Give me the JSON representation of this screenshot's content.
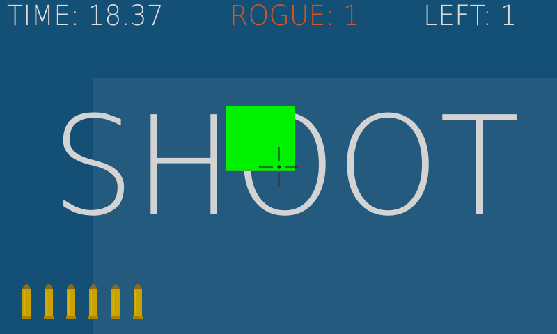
{
  "hud": {
    "time_text": "TIME: 18.37",
    "rogue_text": "ROGUE: 1",
    "left_text": "LEFT: 1"
  },
  "center_text": "SHOOT",
  "ammo": {
    "remaining": 6
  },
  "colors": {
    "background": "#145076",
    "panel": "#235a7e",
    "hud_text": "#dcdcdc",
    "rogue_accent": "#d9541e",
    "target": "#00f100",
    "bullet": "#c9a200"
  },
  "icons": {
    "crosshair": "crosshair-icon",
    "bullet": "bullet-icon"
  }
}
